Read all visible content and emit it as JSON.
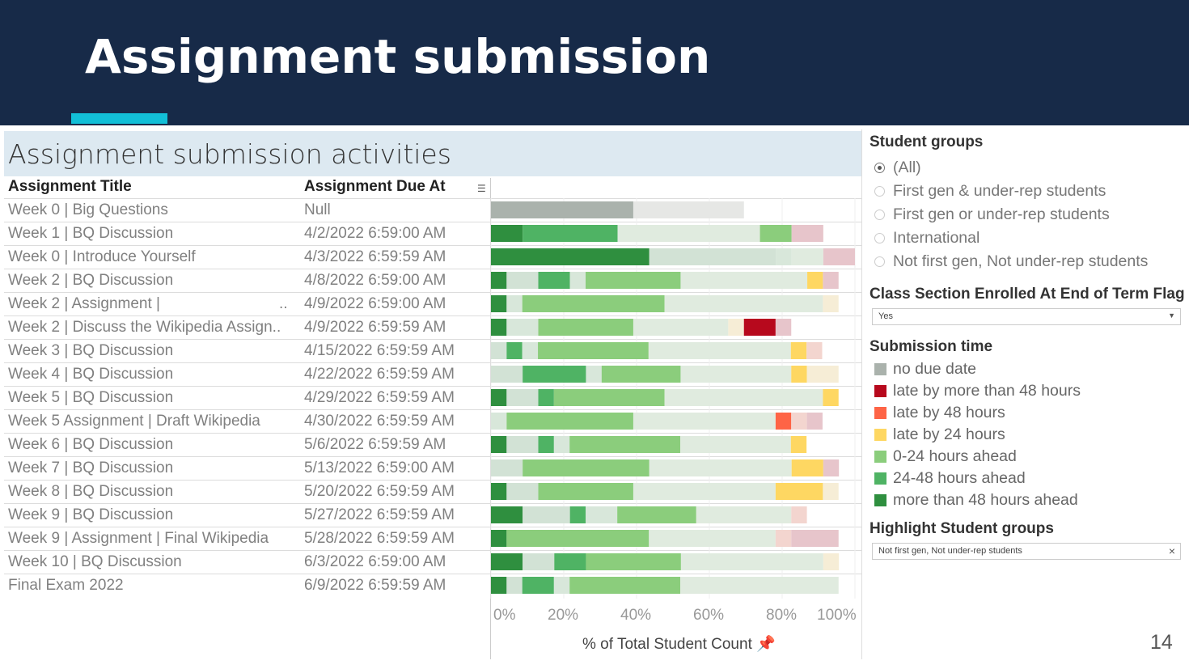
{
  "slide": {
    "title": "Assignment submission",
    "page_number": "14"
  },
  "dashboard": {
    "title": "Assignment submission activities",
    "columns": [
      "Assignment Title",
      "Assignment Due At"
    ],
    "rows": [
      {
        "title": "Week 0 | Big Questions",
        "due": "Null",
        "segments": [
          [
            "nd",
            39.1,
            true
          ],
          [
            "nd",
            30.4,
            false
          ]
        ]
      },
      {
        "title": "Week 1 | BQ Discussion",
        "due": "4/2/2022 6:59:00 AM",
        "segments": [
          [
            "a48p",
            8.7,
            true
          ],
          [
            "a48",
            26.1,
            true
          ],
          [
            "a24",
            39.1,
            false
          ],
          [
            "a24",
            8.7,
            true
          ],
          [
            "l48p",
            8.7,
            false
          ]
        ]
      },
      {
        "title": "Week 0 | Introduce Yourself",
        "due": "4/3/2022 6:59:59 AM",
        "segments": [
          [
            "a48p",
            43.5,
            true
          ],
          [
            "a48p",
            34.8,
            false
          ],
          [
            "a48",
            4.3,
            false
          ],
          [
            "a24",
            8.7,
            false
          ],
          [
            "l48p",
            8.7,
            false
          ]
        ]
      },
      {
        "title": "Week 2 | BQ Discussion",
        "due": "4/8/2022 6:59:00 AM",
        "segments": [
          [
            "a48p",
            4.3,
            true
          ],
          [
            "a48p",
            8.7,
            false
          ],
          [
            "a48",
            8.7,
            true
          ],
          [
            "a48",
            4.3,
            false
          ],
          [
            "a24",
            26.1,
            true
          ],
          [
            "a24",
            34.8,
            false
          ],
          [
            "l24",
            4.3,
            true
          ],
          [
            "l48p",
            4.3,
            false
          ]
        ]
      },
      {
        "title": "Week 2 | Assignment |",
        "ellipsis": "..",
        "due": "4/9/2022 6:59:00 AM",
        "segments": [
          [
            "a48p",
            4.3,
            true
          ],
          [
            "a48",
            4.3,
            false
          ],
          [
            "a24",
            39.1,
            true
          ],
          [
            "a24",
            43.5,
            false
          ],
          [
            "l24",
            4.3,
            false
          ]
        ]
      },
      {
        "title": "Week 2 | Discuss the Wikipedia Assign..",
        "due": "4/9/2022 6:59:59 AM",
        "segments": [
          [
            "a48p",
            4.3,
            true
          ],
          [
            "a48",
            8.7,
            false
          ],
          [
            "a24",
            26.1,
            true
          ],
          [
            "a24",
            26.1,
            false
          ],
          [
            "l24",
            4.3,
            false
          ],
          [
            "l48p",
            8.7,
            true
          ],
          [
            "l48p",
            4.3,
            false
          ]
        ]
      },
      {
        "title": "Week 3 | BQ Discussion",
        "due": "4/15/2022 6:59:59 AM",
        "segments": [
          [
            "a48p",
            4.3,
            false
          ],
          [
            "a48",
            4.3,
            true
          ],
          [
            "a48",
            4.3,
            false
          ],
          [
            "a24",
            30.4,
            true
          ],
          [
            "a24",
            39.1,
            false
          ],
          [
            "l24",
            4.3,
            true
          ],
          [
            "l48",
            4.3,
            false
          ]
        ]
      },
      {
        "title": "Week 4 | BQ Discussion",
        "due": "4/22/2022 6:59:59 AM",
        "segments": [
          [
            "a48p",
            8.7,
            false
          ],
          [
            "a48",
            17.4,
            true
          ],
          [
            "a48",
            4.3,
            false
          ],
          [
            "a24",
            21.7,
            true
          ],
          [
            "a24",
            30.4,
            false
          ],
          [
            "l24",
            4.3,
            true
          ],
          [
            "l24",
            8.7,
            false
          ]
        ]
      },
      {
        "title": "Week 5 | BQ Discussion",
        "due": "4/29/2022 6:59:59 AM",
        "segments": [
          [
            "a48p",
            4.3,
            true
          ],
          [
            "a48p",
            8.7,
            false
          ],
          [
            "a48",
            4.3,
            true
          ],
          [
            "a24",
            30.4,
            true
          ],
          [
            "a24",
            43.5,
            false
          ],
          [
            "l24",
            4.3,
            true
          ]
        ]
      },
      {
        "title": "Week 5 Assignment | Draft Wikipedia",
        "due": "4/30/2022 6:59:59 AM",
        "segments": [
          [
            "a48",
            4.3,
            false
          ],
          [
            "a24",
            34.8,
            true
          ],
          [
            "a24",
            39.1,
            false
          ],
          [
            "l48",
            4.3,
            true
          ],
          [
            "l48",
            4.3,
            false
          ],
          [
            "l48p",
            4.3,
            false
          ]
        ]
      },
      {
        "title": "Week 6 | BQ Discussion",
        "due": "5/6/2022 6:59:59 AM",
        "segments": [
          [
            "a48p",
            4.3,
            true
          ],
          [
            "a48p",
            8.7,
            false
          ],
          [
            "a48",
            4.3,
            true
          ],
          [
            "a48",
            4.3,
            false
          ],
          [
            "a24",
            30.4,
            true
          ],
          [
            "a24",
            30.4,
            false
          ],
          [
            "l24",
            4.3,
            true
          ]
        ]
      },
      {
        "title": "Week 7 | BQ Discussion",
        "due": "5/13/2022 6:59:00 AM",
        "segments": [
          [
            "a48p",
            8.7,
            false
          ],
          [
            "a24",
            34.8,
            true
          ],
          [
            "a24",
            39.1,
            false
          ],
          [
            "l24",
            8.7,
            true
          ],
          [
            "l48p",
            4.3,
            false
          ]
        ]
      },
      {
        "title": "Week 8 | BQ Discussion",
        "due": "5/20/2022 6:59:59 AM",
        "segments": [
          [
            "a48p",
            4.3,
            true
          ],
          [
            "a48p",
            8.7,
            false
          ],
          [
            "a24",
            26.1,
            true
          ],
          [
            "a24",
            39.1,
            false
          ],
          [
            "l24",
            13.0,
            true
          ],
          [
            "l24",
            4.3,
            false
          ]
        ]
      },
      {
        "title": "Week 9 | BQ Discussion",
        "due": "5/27/2022 6:59:59 AM",
        "segments": [
          [
            "a48p",
            8.7,
            true
          ],
          [
            "a48p",
            13.0,
            false
          ],
          [
            "a48",
            4.3,
            true
          ],
          [
            "a48",
            8.7,
            false
          ],
          [
            "a24",
            21.7,
            true
          ],
          [
            "a24",
            26.1,
            false
          ],
          [
            "l48",
            4.3,
            false
          ]
        ]
      },
      {
        "title": "Week 9 | Assignment | Final Wikipedia",
        "due": "5/28/2022 6:59:59 AM",
        "segments": [
          [
            "a48p",
            4.3,
            true
          ],
          [
            "a24",
            39.1,
            true
          ],
          [
            "a24",
            34.8,
            false
          ],
          [
            "l48",
            4.3,
            false
          ],
          [
            "l48p",
            13.0,
            false
          ]
        ]
      },
      {
        "title": "Week 10 | BQ Discussion",
        "due": "6/3/2022 6:59:00 AM",
        "segments": [
          [
            "a48p",
            8.7,
            true
          ],
          [
            "a48p",
            8.7,
            false
          ],
          [
            "a48",
            8.7,
            true
          ],
          [
            "a24",
            26.1,
            true
          ],
          [
            "a24",
            39.1,
            false
          ],
          [
            "l24",
            4.3,
            false
          ]
        ]
      },
      {
        "title": "Final Exam 2022",
        "due": "6/9/2022 6:59:59 AM",
        "segments": [
          [
            "a48p",
            4.3,
            true
          ],
          [
            "a48p",
            4.3,
            false
          ],
          [
            "a48",
            8.7,
            true
          ],
          [
            "a48",
            4.3,
            false
          ],
          [
            "a24",
            30.4,
            true
          ],
          [
            "a24",
            43.5,
            false
          ]
        ]
      }
    ]
  },
  "chart_data": {
    "type": "bar",
    "orientation": "horizontal-stacked",
    "xlabel": "% of Total Student Count",
    "xlim": [
      0,
      100
    ],
    "xticks": [
      "0%",
      "20%",
      "40%",
      "60%",
      "80%",
      "100%"
    ],
    "grid": true,
    "note": "segments: [submission time key, percent, highlighted]"
  },
  "filters": {
    "student_groups": {
      "label": "Student groups",
      "options": [
        "(All)",
        "First gen & under-rep students",
        "First gen or under-rep students",
        "International",
        "Not first gen, Not under-rep students"
      ],
      "selected": "(All)"
    },
    "enrolled_flag": {
      "label": "Class Section Enrolled At End of Term Flag",
      "value": "Yes"
    },
    "highlight": {
      "label": "Highlight Student groups",
      "value": "Not first gen, Not under-rep students"
    }
  },
  "legend": {
    "title": "Submission time",
    "items": [
      {
        "key": "nd",
        "label": "no due date",
        "color": "#aab2ac",
        "faded": "#e6e7e5"
      },
      {
        "key": "l48p",
        "label": "late by more than 48 hours",
        "color": "#b7091d",
        "faded": "#e7c5cb"
      },
      {
        "key": "l48",
        "label": "late by 48 hours",
        "color": "#fe6446",
        "faded": "#f3d5cf"
      },
      {
        "key": "l24",
        "label": "late by 24 hours",
        "color": "#fed762",
        "faded": "#f6edd6"
      },
      {
        "key": "a24",
        "label": "0-24 hours ahead",
        "color": "#8bcd7c",
        "faded": "#e0ebdf"
      },
      {
        "key": "a48",
        "label": "24-48 hours ahead",
        "color": "#4fb364",
        "faded": "#d8e7da"
      },
      {
        "key": "a48p",
        "label": "more than 48 hours ahead",
        "color": "#2f8f3f",
        "faded": "#d2e2d5"
      }
    ]
  },
  "colors": {
    "header_bg": "#172a48",
    "accent": "#12bfd7",
    "band_bg": "#dde9f1"
  }
}
